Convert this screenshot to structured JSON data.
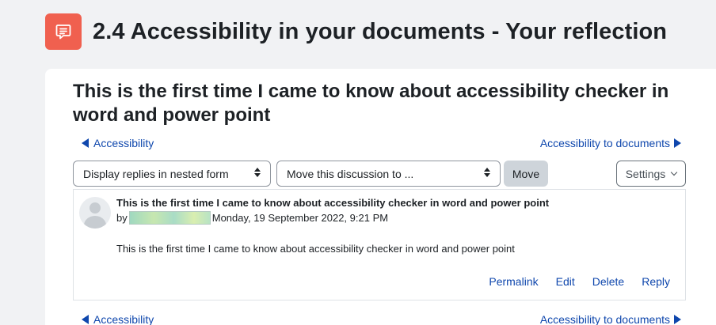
{
  "activity": {
    "icon": "forum-icon",
    "icon_color": "#f0604f",
    "title": "2.4 Accessibility in your documents - Your reflection"
  },
  "discussion": {
    "title": "This is the first time I came to know about accessibility checker in word and power point"
  },
  "navigation": {
    "prev_label": "Accessibility",
    "next_label": "Accessibility to documents"
  },
  "controls": {
    "display_mode": "Display replies in nested form",
    "move_select": "Move this discussion to ...",
    "move_button": "Move",
    "settings_button": "Settings"
  },
  "post": {
    "subject": "This is the first time I came to know about accessibility checker in word and power point",
    "by_prefix": "by",
    "datetime": "Monday, 19 September 2022, 9:21 PM",
    "body": "This is the first time I came to know about accessibility checker in word and power point",
    "actions": {
      "permalink": "Permalink",
      "edit": "Edit",
      "delete": "Delete",
      "reply": "Reply"
    }
  },
  "colors": {
    "link": "#0f47ad",
    "background": "#f1f2f4"
  }
}
